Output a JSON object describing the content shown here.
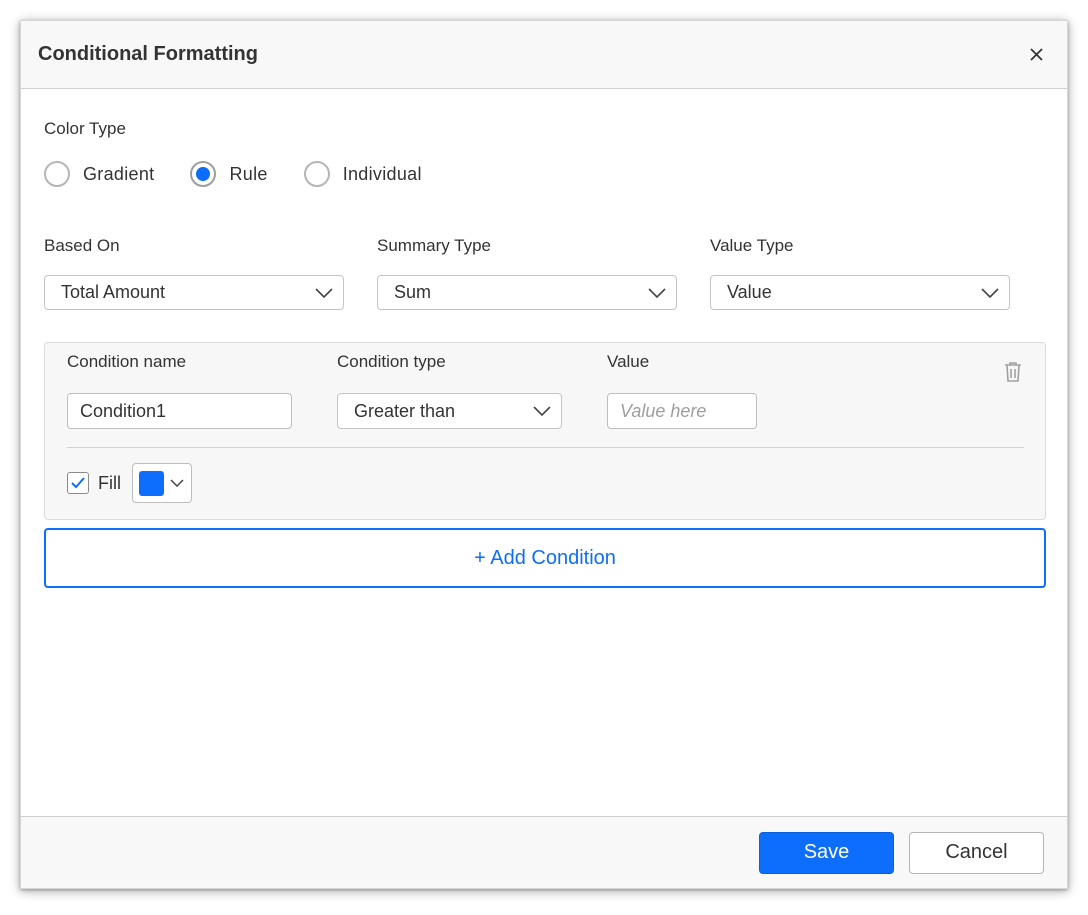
{
  "dialog": {
    "title": "Conditional Formatting",
    "close_icon": "close-icon"
  },
  "color_type": {
    "label": "Color Type",
    "options": [
      {
        "label": "Gradient",
        "checked": false
      },
      {
        "label": "Rule",
        "checked": true
      },
      {
        "label": "Individual",
        "checked": false
      }
    ]
  },
  "based_on": {
    "label": "Based On",
    "value": "Total Amount"
  },
  "summary_type": {
    "label": "Summary Type",
    "value": "Sum"
  },
  "value_type": {
    "label": "Value Type",
    "value": "Value"
  },
  "condition": {
    "name_label": "Condition name",
    "name_value": "Condition1",
    "type_label": "Condition type",
    "type_value": "Greater than",
    "value_label": "Value",
    "value_placeholder": "Value here",
    "delete_icon": "trash-icon",
    "fill_label": "Fill",
    "fill_checked": true,
    "fill_color": "#0d6efd"
  },
  "add_condition_label": "+ Add Condition",
  "footer": {
    "save_label": "Save",
    "cancel_label": "Cancel"
  },
  "colors": {
    "accent": "#0d6efd",
    "header_bg": "#f8f8f8",
    "card_bg": "#f7f7f7"
  }
}
